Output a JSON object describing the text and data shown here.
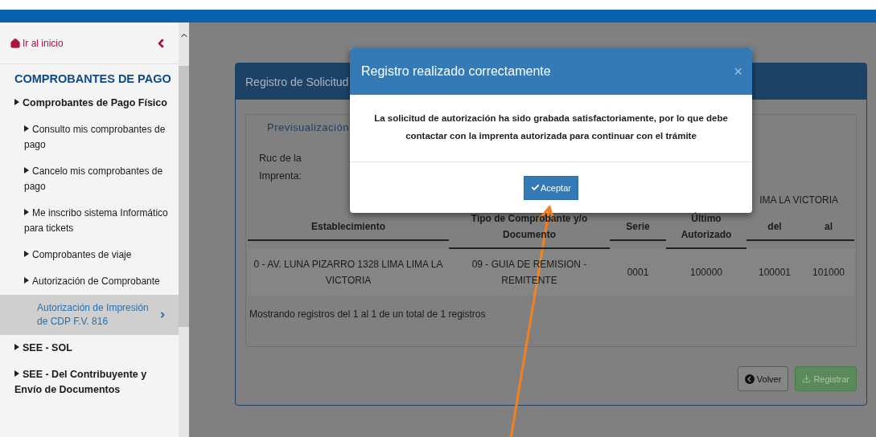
{
  "sidebar": {
    "home_link": "Ir al inicio",
    "section_title": "COMPROBANTES DE PAGO",
    "items": [
      {
        "label": "Comprobantes de Pago Físico",
        "selected": false,
        "children": [
          {
            "label": "Consulto mis comprobantes de pago",
            "selected": false
          },
          {
            "label": "Cancelo mis comprobantes de pago",
            "selected": false
          },
          {
            "label": "Me inscribo sistema Informático para tickets",
            "selected": false
          },
          {
            "label": "Comprobantes de viaje",
            "selected": false
          },
          {
            "label": "Autorización de Comprobante",
            "selected": false,
            "children": [
              {
                "label": "Autorización de Impresión de CDP F.V. 816",
                "selected": true
              }
            ]
          }
        ]
      },
      {
        "label": "SEE - SOL",
        "selected": false
      },
      {
        "label": "SEE - Del Contribuyente y Envío de Documentos",
        "selected": false
      }
    ]
  },
  "panel": {
    "title": "Registro de Solicitud",
    "legend": "Previsualización",
    "ruc_label": "Ruc de la Imprenta:",
    "address_fragment": "IMA LA VICTORIA",
    "table": {
      "columns": [
        "Establecimiento",
        "Tipo de Comprobante y/o Documento",
        "Serie",
        "Último Autorizado",
        "del",
        "al"
      ],
      "rows": [
        [
          "0 - AV. LUNA PIZARRO 1328 LIMA LIMA LA VICTORIA",
          "09 - GUIA DE REMISION - REMITENTE",
          "0001",
          "100000",
          "100001",
          "101000"
        ]
      ]
    },
    "summary": "Mostrando registros del 1 al 1 de un total de 1 registros",
    "buttons": [
      {
        "label": "Volver",
        "kind": "back",
        "disabled": false
      },
      {
        "label": "Registrar",
        "kind": "submit",
        "disabled": true
      }
    ]
  },
  "dialog": {
    "title": "Registro realizado correctamente",
    "close": "×",
    "message": "La solicitud de autorización ha sido grabada satisfactoriamente, por lo que debe contactar con la imprenta autorizada para continuar con el trámite",
    "button": "Aceptar"
  }
}
